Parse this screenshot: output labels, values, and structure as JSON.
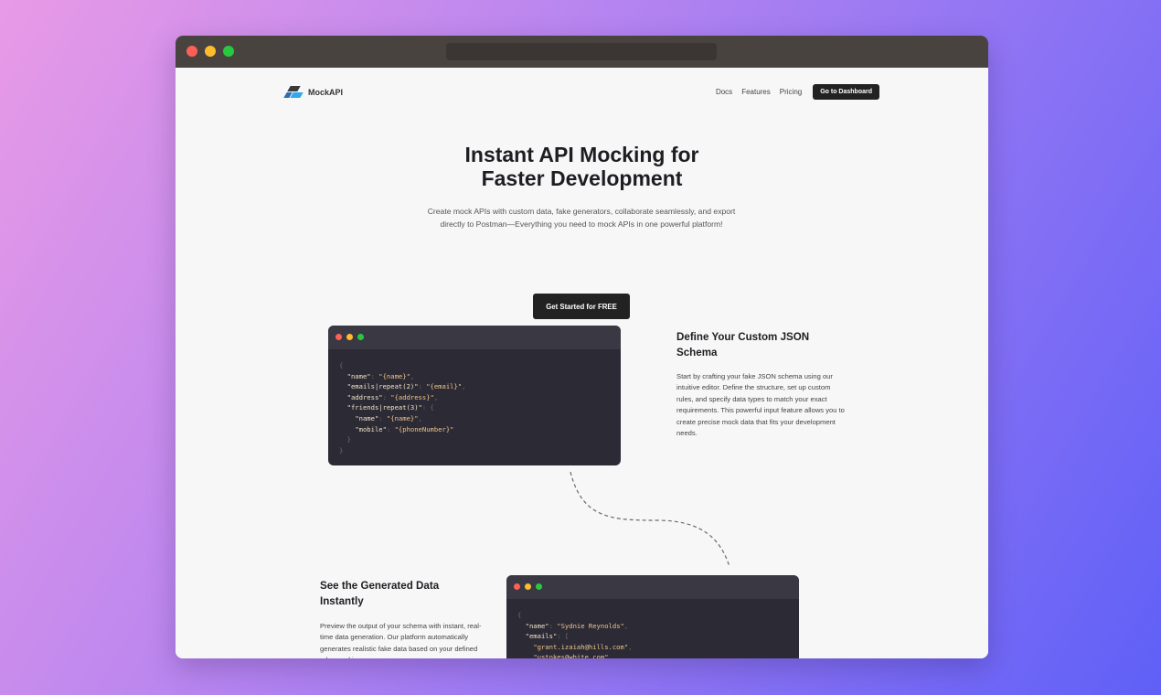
{
  "nav": {
    "logo_text": "MockAPI",
    "links": [
      "Docs",
      "Features",
      "Pricing"
    ],
    "dashboard_button": "Go to Dashboard"
  },
  "hero": {
    "title_line1": "Instant API Mocking for",
    "title_line2": "Faster Development",
    "subtitle_line1": "Create mock APIs with custom data, fake generators, collaborate seamlessly, and export",
    "subtitle_line2": "directly to Postman—Everything you need to mock APIs in one powerful platform!",
    "cta": "Get Started for FREE"
  },
  "feature1": {
    "title": "Define Your Custom JSON Schema",
    "text": "Start by crafting your fake JSON schema using our intuitive editor. Define the structure, set up custom rules, and specify data types to match your exact requirements. This powerful input feature allows you to create precise mock data that fits your development needs.",
    "code": [
      {
        "indent": 0,
        "parts": [
          [
            "p",
            "{"
          ]
        ]
      },
      {
        "indent": 1,
        "parts": [
          [
            "k",
            "\"name\""
          ],
          [
            "p",
            ": "
          ],
          [
            "s",
            "\"{name}\""
          ],
          [
            "p",
            ","
          ]
        ]
      },
      {
        "indent": 1,
        "parts": [
          [
            "k",
            "\"emails|repeat(2)\""
          ],
          [
            "p",
            ": "
          ],
          [
            "s",
            "\"{email}\""
          ],
          [
            "p",
            ","
          ]
        ]
      },
      {
        "indent": 1,
        "parts": [
          [
            "k",
            "\"address\""
          ],
          [
            "p",
            ": "
          ],
          [
            "s",
            "\"{address}\""
          ],
          [
            "p",
            ","
          ]
        ]
      },
      {
        "indent": 1,
        "parts": [
          [
            "k",
            "\"friends|repeat(3)\""
          ],
          [
            "p",
            ": {"
          ]
        ]
      },
      {
        "indent": 2,
        "parts": [
          [
            "k",
            "\"name\""
          ],
          [
            "p",
            ": "
          ],
          [
            "s",
            "\"{name}\""
          ],
          [
            "p",
            ","
          ]
        ]
      },
      {
        "indent": 2,
        "parts": [
          [
            "k",
            "\"mobile\""
          ],
          [
            "p",
            ": "
          ],
          [
            "s",
            "\"{phoneNumber}\""
          ]
        ]
      },
      {
        "indent": 1,
        "parts": [
          [
            "p",
            "}"
          ]
        ]
      },
      {
        "indent": 0,
        "parts": [
          [
            "p",
            "}"
          ]
        ]
      }
    ]
  },
  "feature2": {
    "title": "See the Generated Data Instantly",
    "text": "Preview the output of your schema with instant, real-time data generation. Our platform automatically generates realistic fake data based on your defined rules, making",
    "code": [
      {
        "indent": 0,
        "parts": [
          [
            "p",
            "{"
          ]
        ]
      },
      {
        "indent": 1,
        "parts": [
          [
            "k",
            "\"name\""
          ],
          [
            "p",
            ": "
          ],
          [
            "s",
            "\"Sydnie Reynolds\""
          ],
          [
            "p",
            ","
          ]
        ]
      },
      {
        "indent": 1,
        "parts": [
          [
            "k",
            "\"emails\""
          ],
          [
            "p",
            ": ["
          ]
        ]
      },
      {
        "indent": 2,
        "parts": [
          [
            "s",
            "\"grant.izaiah@hills.com\""
          ],
          [
            "p",
            ","
          ]
        ]
      },
      {
        "indent": 2,
        "parts": [
          [
            "s",
            "\"ustokes@white.com\""
          ]
        ]
      }
    ]
  },
  "colors": {
    "background_gradient_start": "#e89ae6",
    "background_gradient_end": "#5f60f7",
    "code_bg": "#2c2b35",
    "code_string": "#f0c48a",
    "code_key": "#f1e3c8",
    "button_bg": "#222222"
  }
}
